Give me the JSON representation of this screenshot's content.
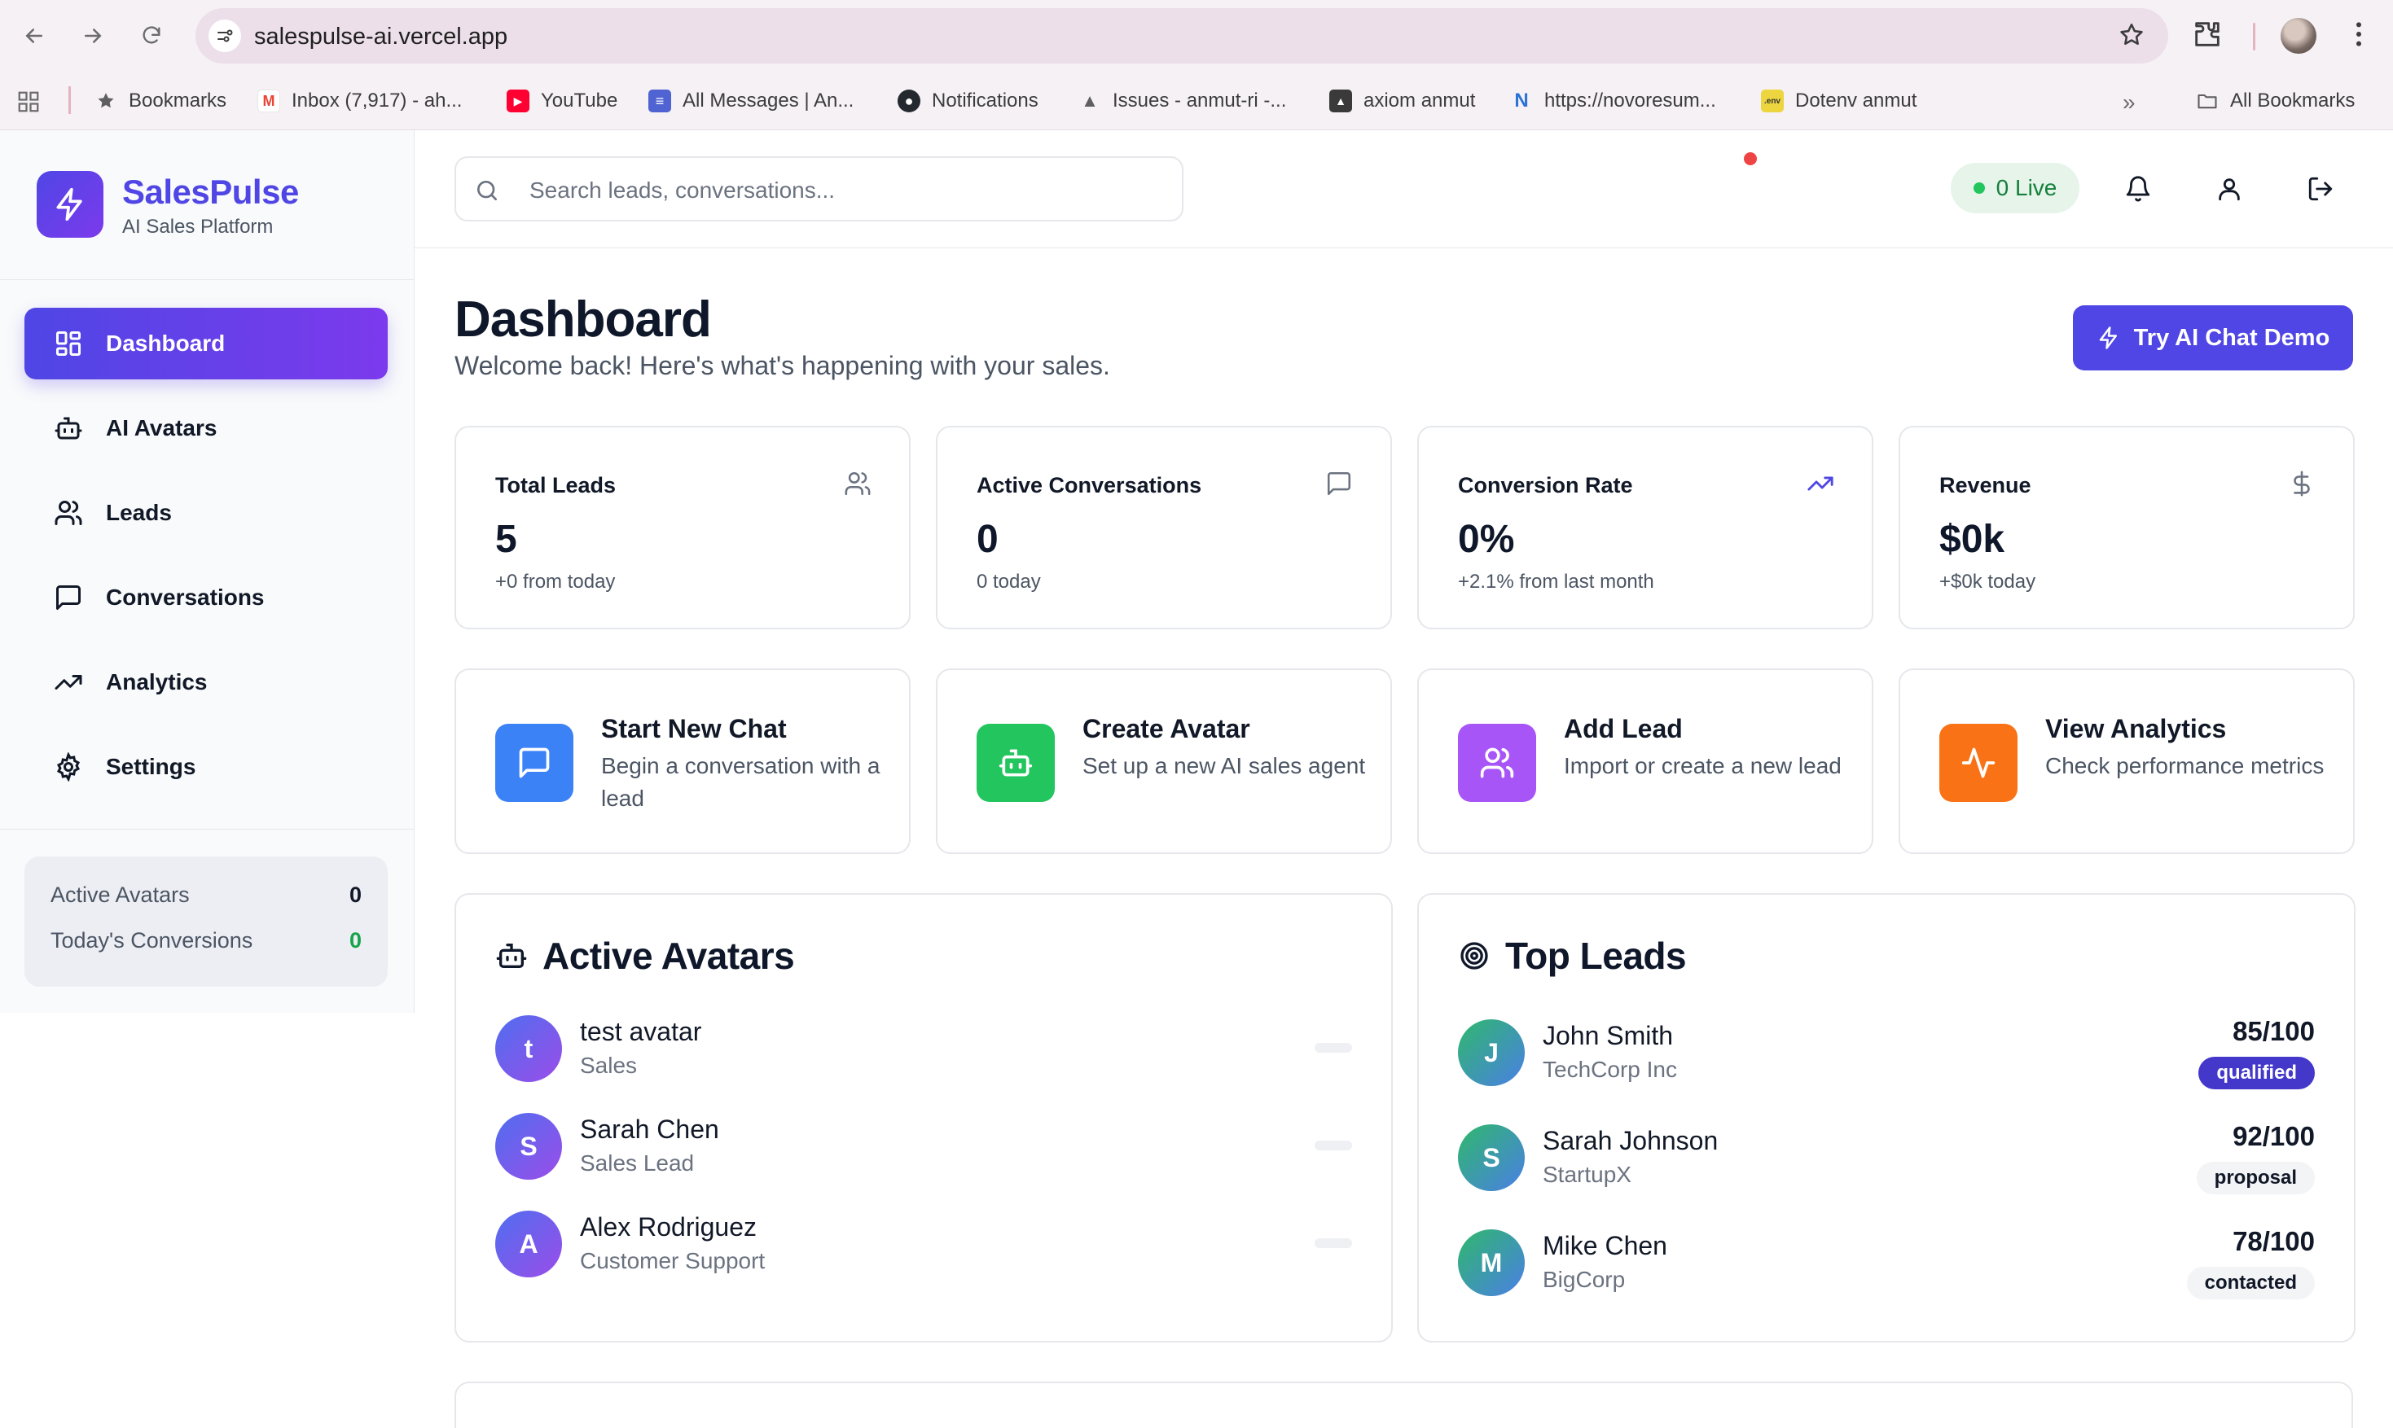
{
  "browser": {
    "url": "salespulse-ai.vercel.app",
    "bookmarks": [
      {
        "label": "Bookmarks",
        "icon": "star-icon"
      },
      {
        "label": "Inbox (7,917) - ah...",
        "icon": "gmail-icon"
      },
      {
        "label": "YouTube",
        "icon": "youtube-icon"
      },
      {
        "label": "All Messages | An...",
        "icon": "messages-icon"
      },
      {
        "label": "Notifications",
        "icon": "github-icon"
      },
      {
        "label": "Issues - anmut-ri -...",
        "icon": "issues-icon"
      },
      {
        "label": "axiom anmut",
        "icon": "axiom-icon"
      },
      {
        "label": "https://novoresum...",
        "icon": "novoresume-icon"
      },
      {
        "label": "Dotenv anmut",
        "icon": "dotenv-icon"
      }
    ],
    "all_bookmarks": "All Bookmarks"
  },
  "sidebar": {
    "brand_name": "SalesPulse",
    "brand_sub": "AI Sales Platform",
    "items": [
      {
        "label": "Dashboard",
        "icon": "grid-icon",
        "active": true
      },
      {
        "label": "AI Avatars",
        "icon": "bot-icon"
      },
      {
        "label": "Leads",
        "icon": "users-icon"
      },
      {
        "label": "Conversations",
        "icon": "message-icon"
      },
      {
        "label": "Analytics",
        "icon": "trending-up-icon"
      },
      {
        "label": "Settings",
        "icon": "gear-icon"
      }
    ],
    "stats": [
      {
        "label": "Active Avatars",
        "value": "0"
      },
      {
        "label": "Today's Conversions",
        "value": "0"
      }
    ]
  },
  "topbar": {
    "search_placeholder": "Search leads, conversations...",
    "live_label": "0 Live"
  },
  "main": {
    "title": "Dashboard",
    "subtitle": "Welcome back! Here's what's happening with your sales.",
    "demo_button": "Try AI Chat Demo",
    "stats": [
      {
        "label": "Total Leads",
        "value": "5",
        "sub": "+0 from today",
        "icon": "users-icon"
      },
      {
        "label": "Active Conversations",
        "value": "0",
        "sub": "0 today",
        "icon": "message-icon"
      },
      {
        "label": "Conversion Rate",
        "value": "0%",
        "sub": "+2.1% from last month",
        "icon": "trending-up-icon"
      },
      {
        "label": "Revenue",
        "value": "$0k",
        "sub": "+$0k today",
        "icon": "dollar-icon"
      }
    ],
    "actions": [
      {
        "title": "Start New Chat",
        "desc": "Begin a conversation with a lead",
        "color": "#3b82f6",
        "icon": "message-icon"
      },
      {
        "title": "Create Avatar",
        "desc": "Set up a new AI sales agent",
        "color": "#22c55e",
        "icon": "bot-icon"
      },
      {
        "title": "Add Lead",
        "desc": "Import or create a new lead",
        "color": "#a855f7",
        "icon": "users-icon"
      },
      {
        "title": "View Analytics",
        "desc": "Check performance metrics",
        "color": "#f97316",
        "icon": "activity-icon"
      }
    ],
    "active_avatars": {
      "title": "Active Avatars",
      "items": [
        {
          "initial": "t",
          "name": "test avatar",
          "role": "Sales"
        },
        {
          "initial": "S",
          "name": "Sarah Chen",
          "role": "Sales Lead"
        },
        {
          "initial": "A",
          "name": "Alex Rodriguez",
          "role": "Customer Support"
        }
      ]
    },
    "top_leads": {
      "title": "Top Leads",
      "items": [
        {
          "initial": "J",
          "name": "John Smith",
          "company": "TechCorp Inc",
          "score": "85/100",
          "status": "qualified"
        },
        {
          "initial": "S",
          "name": "Sarah Johnson",
          "company": "StartupX",
          "score": "92/100",
          "status": "proposal"
        },
        {
          "initial": "M",
          "name": "Mike Chen",
          "company": "BigCorp",
          "score": "78/100",
          "status": "contacted"
        }
      ]
    }
  }
}
